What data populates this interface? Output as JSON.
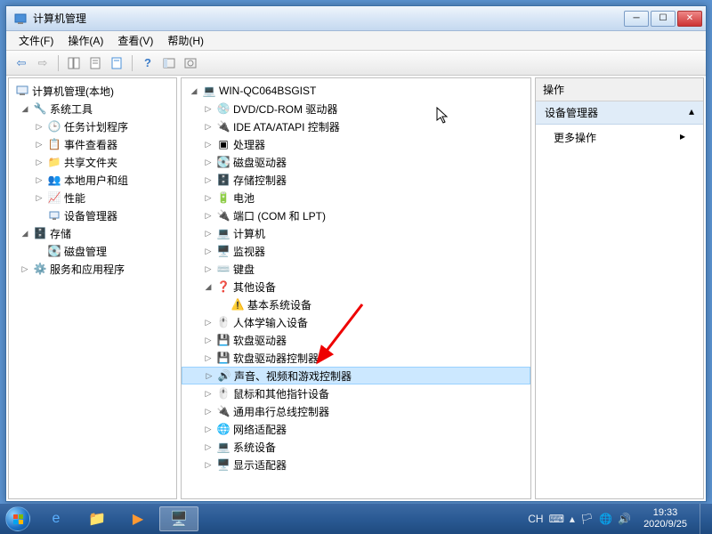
{
  "window": {
    "title": "计算机管理"
  },
  "menubar": {
    "file": "文件(F)",
    "action": "操作(A)",
    "view": "查看(V)",
    "help": "帮助(H)"
  },
  "left_tree": {
    "root": "计算机管理(本地)",
    "system_tools": "系统工具",
    "task_scheduler": "任务计划程序",
    "event_viewer": "事件查看器",
    "shared_folders": "共享文件夹",
    "local_users": "本地用户和组",
    "performance": "性能",
    "device_manager": "设备管理器",
    "storage": "存储",
    "disk_mgmt": "磁盘管理",
    "services_apps": "服务和应用程序"
  },
  "mid_tree": {
    "root": "WIN-QC064BSGIST",
    "dvd": "DVD/CD-ROM 驱动器",
    "ide": "IDE ATA/ATAPI 控制器",
    "cpu": "处理器",
    "disk_drives": "磁盘驱动器",
    "storage_ctrl": "存储控制器",
    "battery": "电池",
    "ports": "端口 (COM 和 LPT)",
    "computer": "计算机",
    "monitor": "监视器",
    "keyboard": "键盘",
    "other": "其他设备",
    "base_sys": "基本系统设备",
    "hid": "人体学输入设备",
    "floppy_drives": "软盘驱动器",
    "floppy_ctrl": "软盘驱动器控制器",
    "sound": "声音、视频和游戏控制器",
    "mouse": "鼠标和其他指针设备",
    "usb": "通用串行总线控制器",
    "network": "网络适配器",
    "system_devices": "系统设备",
    "display": "显示适配器"
  },
  "actions": {
    "header": "操作",
    "sub": "设备管理器",
    "more": "更多操作"
  },
  "tray": {
    "lang": "CH",
    "time": "19:33",
    "date": "2020/9/25"
  }
}
